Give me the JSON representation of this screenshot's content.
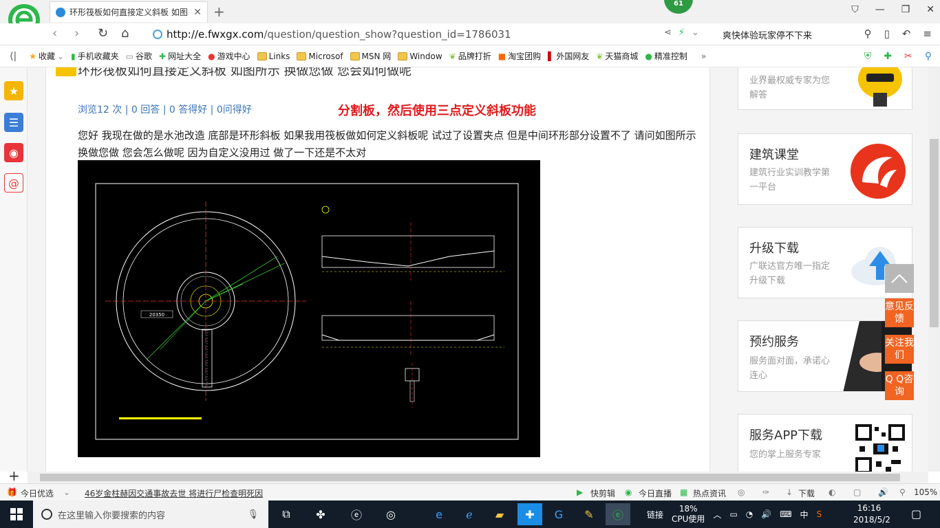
{
  "browser": {
    "tab_title": "环形筏板如何直接定义斜板 如图",
    "badge": "61",
    "url_host": "http://e.fwxgx.com",
    "url_path": "/question/question_show?question_id=1786031",
    "search_suggest": "爽快体验玩家停不下来"
  },
  "bookmarks": [
    {
      "label": "收藏",
      "icon": "star-icon"
    },
    {
      "label": "手机收藏夹",
      "icon": "phone-icon"
    },
    {
      "label": "谷歌",
      "icon": "page-icon"
    },
    {
      "label": "网址大全",
      "icon": "sites-icon"
    },
    {
      "label": "游戏中心",
      "icon": "game-icon"
    },
    {
      "label": "Links",
      "icon": "folder-icon"
    },
    {
      "label": "Microsof",
      "icon": "folder-icon"
    },
    {
      "label": "MSN 网",
      "icon": "folder-icon"
    },
    {
      "label": "Window",
      "icon": "folder-icon"
    },
    {
      "label": "品牌打折",
      "icon": "leaf-icon"
    },
    {
      "label": "淘宝团购",
      "icon": "taobao-icon"
    },
    {
      "label": "外国网友",
      "icon": "flag-icon"
    },
    {
      "label": "天猫商城",
      "icon": "leaf-icon"
    },
    {
      "label": "精准控制",
      "icon": "chat-icon"
    }
  ],
  "article": {
    "title": "环形筏板如何直接定义斜板 如图所示 换做您做 您会如何做呢",
    "stats": "浏览12 次 | 0 回答 | 0 答得好 | 0问得好",
    "note": "分割板，然后使用三点定义斜板功能",
    "body": "您好   我现在做的是水池改造   底部是环形斜板   如果我用筏板做如何定义斜板呢     试过了设置夹点   但是中间环形部分设置不了    请问如图所示  换做您做   您会怎么做呢   因为自定义没用过   做了一下还是不太对"
  },
  "cad": {
    "dimension_label": "20350"
  },
  "right_cards": [
    {
      "title": "",
      "subtitle": "业界最权威专家为您解答"
    },
    {
      "title": "建筑课堂",
      "subtitle": "建筑行业实训教学第一平台"
    },
    {
      "title": "升级下载",
      "subtitle": "广联达官方唯一指定升级下载"
    },
    {
      "title": "预约服务",
      "subtitle": "服务面对面，承诺心连心"
    },
    {
      "title": "服务APP下载",
      "subtitle": "您的掌上服务专家"
    }
  ],
  "float_buttons": [
    "意见反馈",
    "关注我们",
    "Q Q咨询"
  ],
  "statusbar": {
    "today": "今日优选",
    "news": "46岁金柱赫因交通事故去世 将进行尸检查明死因",
    "quick_edit": "快剪辑",
    "live": "今日直播",
    "hot": "热点资讯",
    "download": "下载",
    "zoom": "105%"
  },
  "taskbar": {
    "search_placeholder": "在这里输入你要搜索的内容",
    "link": "链接",
    "cpu_pct": "18%",
    "cpu_label": "CPU使用",
    "ime": "中",
    "time": "16:16",
    "date": "2018/5/2"
  }
}
